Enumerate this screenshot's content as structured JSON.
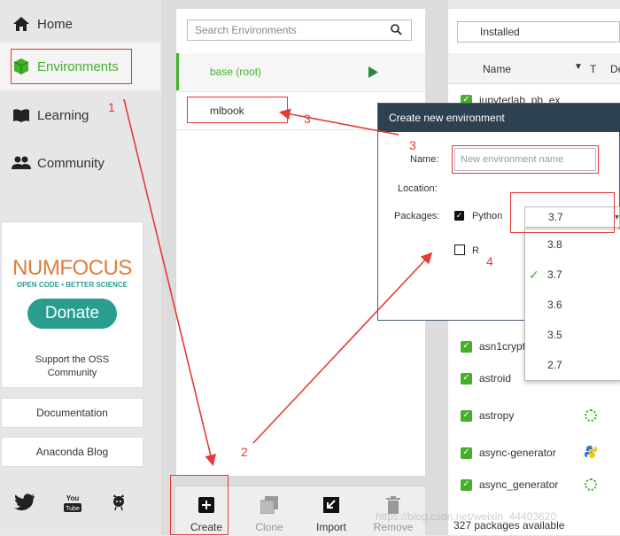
{
  "nav": {
    "items": [
      {
        "label": "Home",
        "icon": "home-icon"
      },
      {
        "label": "Environments",
        "icon": "cube-icon"
      },
      {
        "label": "Learning",
        "icon": "book-icon"
      },
      {
        "label": "Community",
        "icon": "people-icon"
      }
    ],
    "numfocus": {
      "logo": "NUMFOCUS",
      "tagline": "OPEN CODE • BETTER SCIENCE",
      "donate": "Donate",
      "support": "Support the OSS Community"
    },
    "documentation": "Documentation",
    "blog": "Anaconda Blog",
    "social": [
      "twitter-icon",
      "youtube-icon",
      "github-icon"
    ],
    "youtube_text": "You Tube"
  },
  "envs": {
    "search_placeholder": "Search Environments",
    "items": [
      {
        "name": "base (root)",
        "active": true
      },
      {
        "name": "mlbook",
        "active": false
      }
    ]
  },
  "toolbar": {
    "create": "Create",
    "clone": "Clone",
    "import": "Import",
    "remove": "Remove"
  },
  "packages": {
    "filter": "Installed",
    "col_name": "Name",
    "col_t": "T",
    "col_d": "De",
    "rows": [
      "jupyterlab_pb_ex",
      "asn1crypto",
      "astroid",
      "astropy",
      "async-generator",
      "async_generator"
    ],
    "count": "327 packages available"
  },
  "dialog": {
    "title": "Create new environment",
    "name_label": "Name:",
    "name_placeholder": "New environment name",
    "location_label": "Location:",
    "packages_label": "Packages:",
    "python_label": "Python",
    "python_version": "3.7",
    "r_label": "R"
  },
  "dropdown": {
    "options": [
      "3.8",
      "3.7",
      "3.6",
      "3.5",
      "2.7"
    ],
    "selected": "3.7"
  },
  "annotations": [
    "1",
    "2",
    "3",
    "3",
    "4"
  ],
  "watermark": "https://blog.csdn.net/weixin_44403620",
  "colors": {
    "accent": "#43b02a",
    "annotation": "#e53935",
    "dialog_header": "#2e4150"
  }
}
